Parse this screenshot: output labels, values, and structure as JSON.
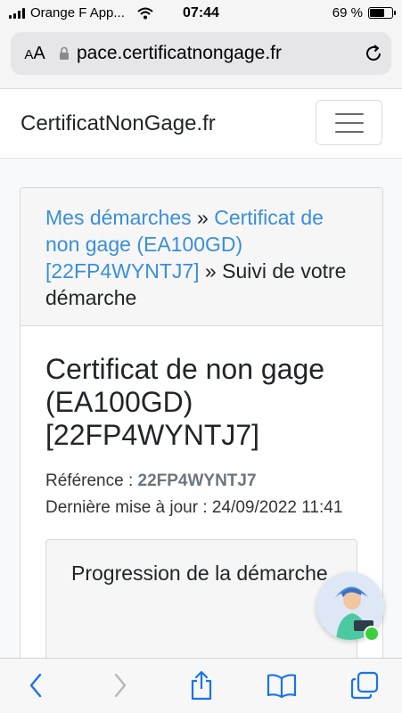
{
  "status_bar": {
    "carrier": "Orange F App...",
    "time": "07:44",
    "battery_percent_label": "69 %",
    "battery_level": 0.69
  },
  "browser": {
    "aa_label_small": "A",
    "aa_label_large": "A",
    "url": "pace.certificatnongage.fr"
  },
  "navbar": {
    "brand": "CertificatNonGage.fr"
  },
  "breadcrumb": {
    "link1": "Mes démarches",
    "sep1": " » ",
    "link2": "Certificat de non gage (EA100GD) [22FP4WYNTJ7]",
    "sep2": " » ",
    "current": "Suivi de votre démarche"
  },
  "main": {
    "title": "Certificat de non gage (EA100GD) [22FP4WYNTJ7]",
    "reference_label": "Référence : ",
    "reference_value": "22FP4WYNTJ7",
    "updated_label": "Dernière mise à jour : ",
    "updated_value": "24/09/2022 11:41",
    "progress_title": "Progression de la démarche"
  },
  "icons": {
    "lock": "lock-icon",
    "reload": "reload-icon",
    "menu": "hamburger-icon",
    "back": "chevron-left-icon",
    "forward": "chevron-right-icon",
    "share": "share-icon",
    "bookmarks": "book-icon",
    "tabs": "tabs-icon",
    "chat": "chat-avatar-icon"
  },
  "colors": {
    "link": "#3a8fd8",
    "toolbar_accent": "#1a73e8",
    "online": "#3bd13b"
  }
}
